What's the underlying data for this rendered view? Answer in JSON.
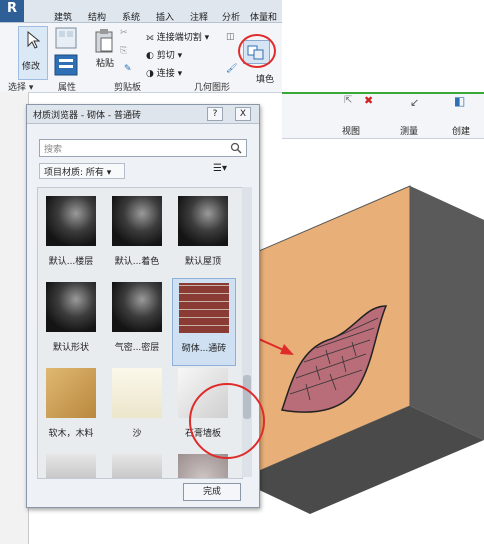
{
  "ribbon": {
    "tabs": [
      "建筑",
      "结构",
      "系统",
      "插入",
      "注释",
      "分析",
      "体量和"
    ],
    "modify_label": "修改",
    "paste_label": "粘贴",
    "cut_join": {
      "join_cut": "连接端切割",
      "cut": "剪切",
      "connect": "连接"
    },
    "panels": [
      "选择",
      "属性",
      "剪贴板",
      "几何图形"
    ],
    "fill_label": "填色",
    "right_labels": [
      "视图",
      "测量",
      "创建"
    ]
  },
  "dialog": {
    "title": "材质浏览器 - 砌体 - 普通砖",
    "help_btn": "?",
    "close_btn": "X",
    "search_placeholder": "搜索",
    "filter": "项目材质: 所有",
    "materials": [
      {
        "label": "默认...楼层",
        "kind": "sphere"
      },
      {
        "label": "默认...着色",
        "kind": "sphere"
      },
      {
        "label": "默认屋顶",
        "kind": "sphere"
      },
      {
        "label": "默认形状",
        "kind": "sphere"
      },
      {
        "label": "气密...密层",
        "kind": "sphere"
      },
      {
        "label": "砌体...通砖",
        "kind": "brick"
      },
      {
        "label": "软木，木料",
        "kind": "wood"
      },
      {
        "label": "沙",
        "kind": "sand"
      },
      {
        "label": "石膏墙板",
        "kind": "plaster"
      },
      {
        "label": "",
        "kind": "grey"
      },
      {
        "label": "",
        "kind": "grey"
      },
      {
        "label": "",
        "kind": "stone"
      }
    ],
    "done_label": "完成"
  },
  "colors": {
    "accent": "#e02b2b",
    "wall": "#e8b078",
    "brick": "#b86d78",
    "frame": "#4a4a4a"
  }
}
